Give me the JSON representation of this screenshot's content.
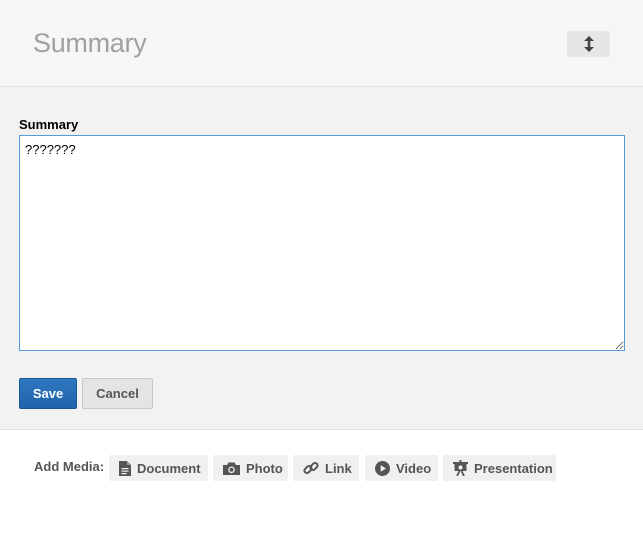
{
  "header": {
    "title": "Summary",
    "reorder_icon": "up-down-arrow-icon"
  },
  "form": {
    "field_label": "Summary",
    "textarea_value": "???????",
    "save_label": "Save",
    "cancel_label": "Cancel",
    "focus_color": "#5b9bd5",
    "save_color": "#2a70b8"
  },
  "media": {
    "label": "Add Media:",
    "buttons": [
      {
        "label": "Document",
        "icon": "document-icon"
      },
      {
        "label": "Photo",
        "icon": "camera-icon"
      },
      {
        "label": "Link",
        "icon": "link-icon"
      },
      {
        "label": "Video",
        "icon": "play-icon"
      },
      {
        "label": "Presentation",
        "icon": "presentation-icon"
      }
    ]
  }
}
